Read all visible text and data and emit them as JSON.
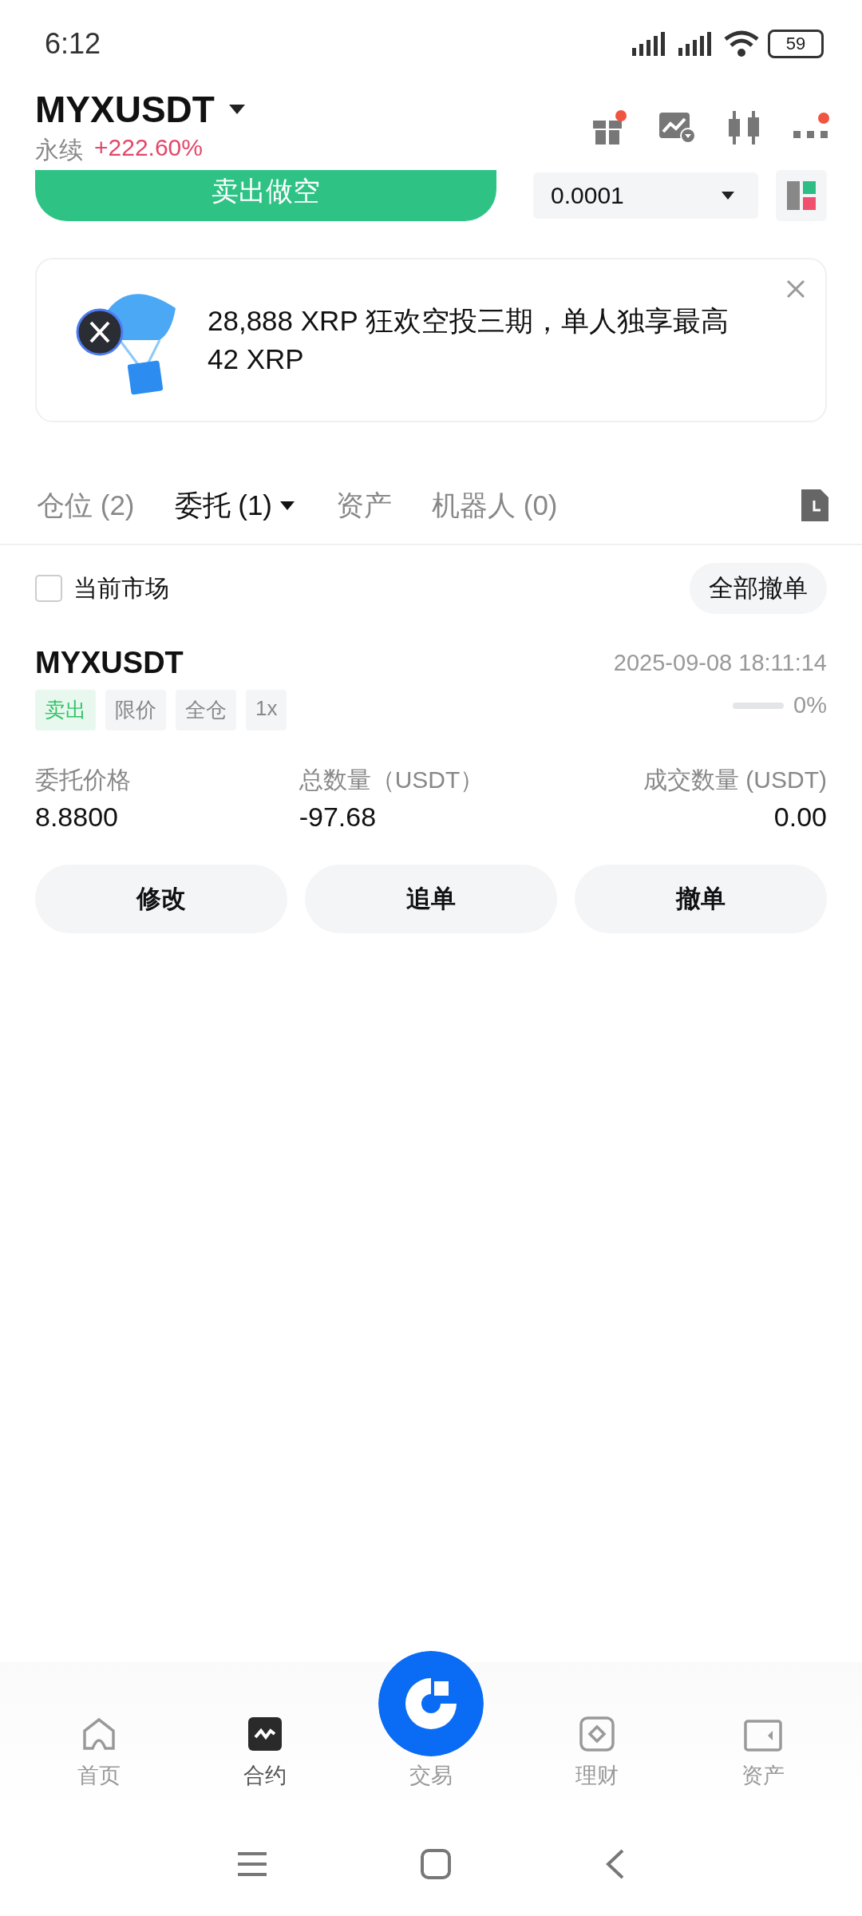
{
  "status_bar": {
    "time": "6:12",
    "battery": "59"
  },
  "header": {
    "symbol": "MYXUSDT",
    "contract_type": "永续",
    "change": "+222.60%"
  },
  "trade_strip": {
    "sell_button": "卖出做空",
    "precision": "0.0001"
  },
  "banner": {
    "text": "28,888 XRP 狂欢空投三期，单人独享最高 42 XRP"
  },
  "tabs": [
    {
      "label": "仓位 (2)",
      "selected": false,
      "dropdown": false
    },
    {
      "label": "委托 (1)",
      "selected": true,
      "dropdown": true
    },
    {
      "label": "资产",
      "selected": false,
      "dropdown": false
    },
    {
      "label": "机器人 (0)",
      "selected": false,
      "dropdown": false
    }
  ],
  "filter": {
    "label": "当前市场",
    "checked": false,
    "cancel_all": "全部撤单"
  },
  "orders": [
    {
      "symbol": "MYXUSDT",
      "time": "2025-09-08 18:11:14",
      "tags": [
        {
          "label": "卖出",
          "kind": "side"
        },
        {
          "label": "限价",
          "kind": "plain"
        },
        {
          "label": "全仓",
          "kind": "plain"
        },
        {
          "label": "1x",
          "kind": "plain"
        }
      ],
      "fill": {
        "level": 0,
        "reading": "0%"
      },
      "fields": [
        {
          "label": "委托价格",
          "value": "8.8800"
        },
        {
          "label": "总数量（USDT）",
          "value": "-97.68"
        },
        {
          "label": "成交数量 (USDT)",
          "value": "0.00"
        }
      ],
      "actions": [
        "修改",
        "追单",
        "撤单"
      ]
    }
  ],
  "bottom_nav": [
    {
      "label": "首页",
      "kind": "home",
      "selected": false
    },
    {
      "label": "合约",
      "kind": "contract",
      "selected": true
    },
    {
      "label": "交易",
      "kind": "trade",
      "selected": false
    },
    {
      "label": "理财",
      "kind": "earn",
      "selected": false
    },
    {
      "label": "资产",
      "kind": "assets",
      "selected": false
    }
  ]
}
